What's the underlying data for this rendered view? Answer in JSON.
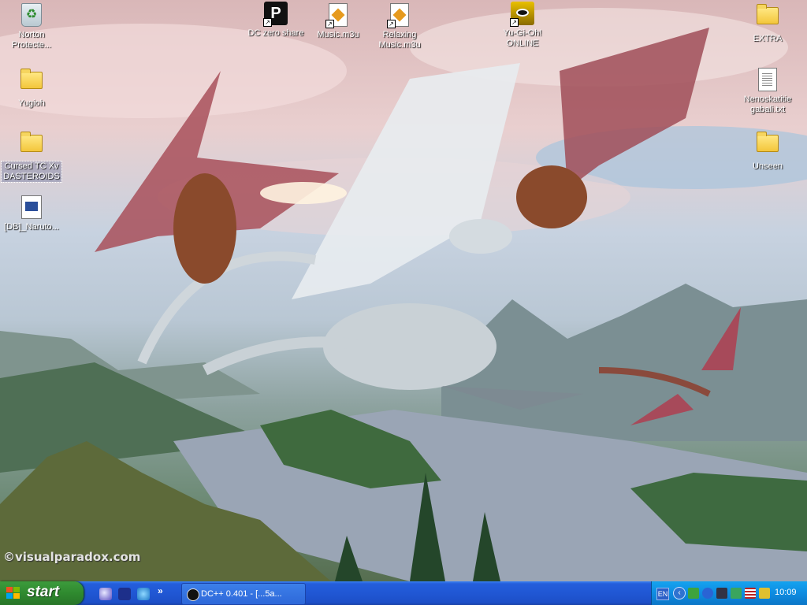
{
  "desktop": {
    "icons": [
      {
        "id": "norton",
        "label": "Norton Protecte..."
      },
      {
        "id": "yugioh",
        "label": "Yugioh"
      },
      {
        "id": "cursed",
        "label": "Cursed TC Xv DASTEROIDS"
      },
      {
        "id": "naruto",
        "label": "[DB]_Naruto..."
      },
      {
        "id": "dczero",
        "label": "DC zero share"
      },
      {
        "id": "musicm3u",
        "label": "Music.m3u"
      },
      {
        "id": "relaxing",
        "label": "Relaxing Music.m3u"
      },
      {
        "id": "ygoonline",
        "label": "Yu-Gi-Oh! ONLINE"
      },
      {
        "id": "extra",
        "label": "EXTRA"
      },
      {
        "id": "nenoskatitie",
        "label": "Nenoskatitie gabali.txt"
      },
      {
        "id": "unseen",
        "label": "Unseen"
      }
    ],
    "watermark": "©visualparadox.com"
  },
  "taskbar": {
    "start_label": "start",
    "quicklaunch_more": "»",
    "tasks": [
      {
        "label": "DC++ 0.401 - [...5a..."
      }
    ],
    "tray": {
      "language": "EN",
      "toggle": "‹",
      "clock": "10:09"
    },
    "colors": {
      "taskbar": "#245edb",
      "start": "#2f8a2f",
      "tray": "#0f8ce1"
    }
  }
}
